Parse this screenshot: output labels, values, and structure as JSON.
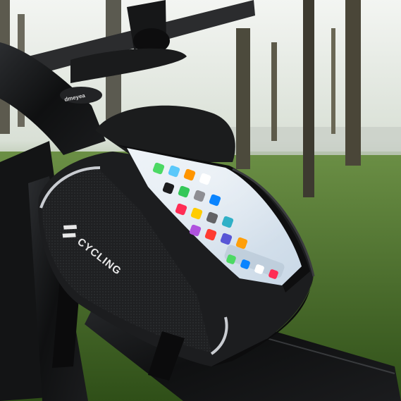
{
  "product": {
    "brand_text": "CYCLING",
    "stem_brand_text": "dmeyea"
  },
  "colors": {
    "bag_body": "#1c1d1f",
    "bag_texture": "#2a2b2e",
    "trim": "#c9ccd1",
    "bike_frame": "#0f1011",
    "grass": "#4f7a2a",
    "phone_screen": "#dce6ef"
  },
  "icons": [
    "phone-icon",
    "messages-icon",
    "photos-icon",
    "calendar-icon",
    "clock-icon",
    "maps-icon",
    "camera-icon",
    "weather-icon",
    "settings-icon",
    "music-icon"
  ]
}
